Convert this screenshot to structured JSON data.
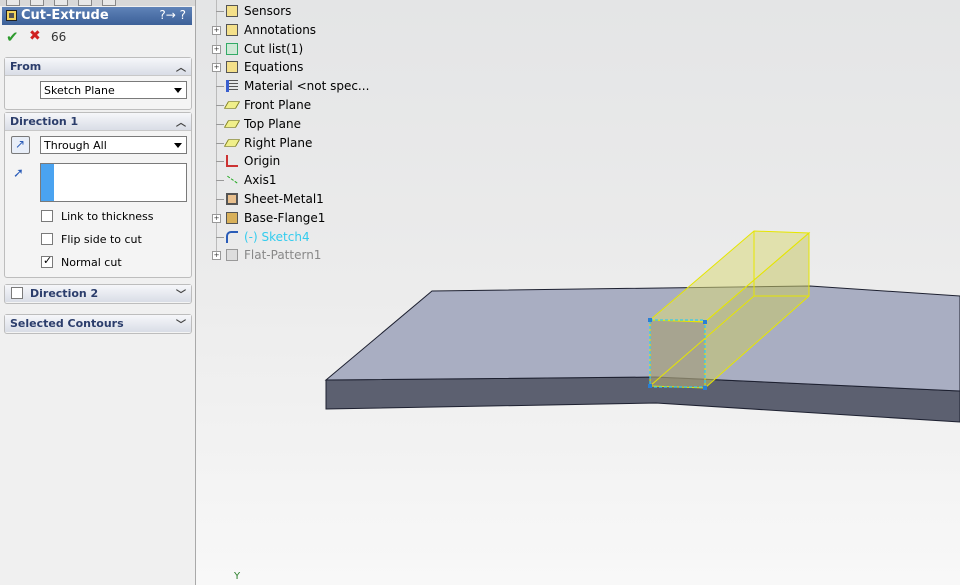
{
  "property_manager": {
    "title": "Cut-Extrude",
    "help_icons": "?→ ?",
    "ok": "✔",
    "cancel": "✖",
    "preview": "66",
    "from": {
      "header": "From",
      "start_condition": "Sketch Plane"
    },
    "direction1": {
      "header": "Direction 1",
      "end_condition": "Through All",
      "depth_value": "",
      "link_to_thickness": "Link to thickness",
      "flip_side_to_cut": "Flip side to cut",
      "normal_cut": "Normal cut",
      "checks": {
        "link_to_thickness": false,
        "flip_side_to_cut": false,
        "normal_cut": true
      }
    },
    "direction2": {
      "header": "Direction 2",
      "checked": false
    },
    "selected_contours": {
      "header": "Selected Contours"
    }
  },
  "feature_tree": [
    {
      "label": "Sensors",
      "icon": "sensors-icon",
      "expandable": false
    },
    {
      "label": "Annotations",
      "icon": "annotations-icon",
      "expandable": true
    },
    {
      "label": "Cut list(1)",
      "icon": "cut-list-icon",
      "expandable": true
    },
    {
      "label": "Equations",
      "icon": "equations-icon",
      "expandable": true
    },
    {
      "label": "Material <not spec...",
      "icon": "material-icon",
      "expandable": false
    },
    {
      "label": "Front Plane",
      "icon": "plane-icon",
      "expandable": false
    },
    {
      "label": "Top Plane",
      "icon": "plane-icon",
      "expandable": false
    },
    {
      "label": "Right Plane",
      "icon": "plane-icon",
      "expandable": false
    },
    {
      "label": "Origin",
      "icon": "origin-icon",
      "expandable": false
    },
    {
      "label": "Axis1",
      "icon": "axis-icon",
      "expandable": false
    },
    {
      "label": "Sheet-Metal1",
      "icon": "sheet-metal-icon",
      "expandable": false
    },
    {
      "label": "Base-Flange1",
      "icon": "base-flange-icon",
      "expandable": true
    },
    {
      "label": "(-) Sketch4",
      "icon": "sketch-icon",
      "expandable": false,
      "color": "#33ccee"
    },
    {
      "label": "Flat-Pattern1",
      "icon": "flat-pattern-icon",
      "expandable": true,
      "color": "#888888"
    }
  ],
  "axis_label": "Y",
  "colors": {
    "header_blue": "#3c6098",
    "plate_top": "#a9aec2",
    "plate_side": "#5c6070",
    "preview_yellow": "#e6e600",
    "sketch_cyan": "#33ccee"
  }
}
